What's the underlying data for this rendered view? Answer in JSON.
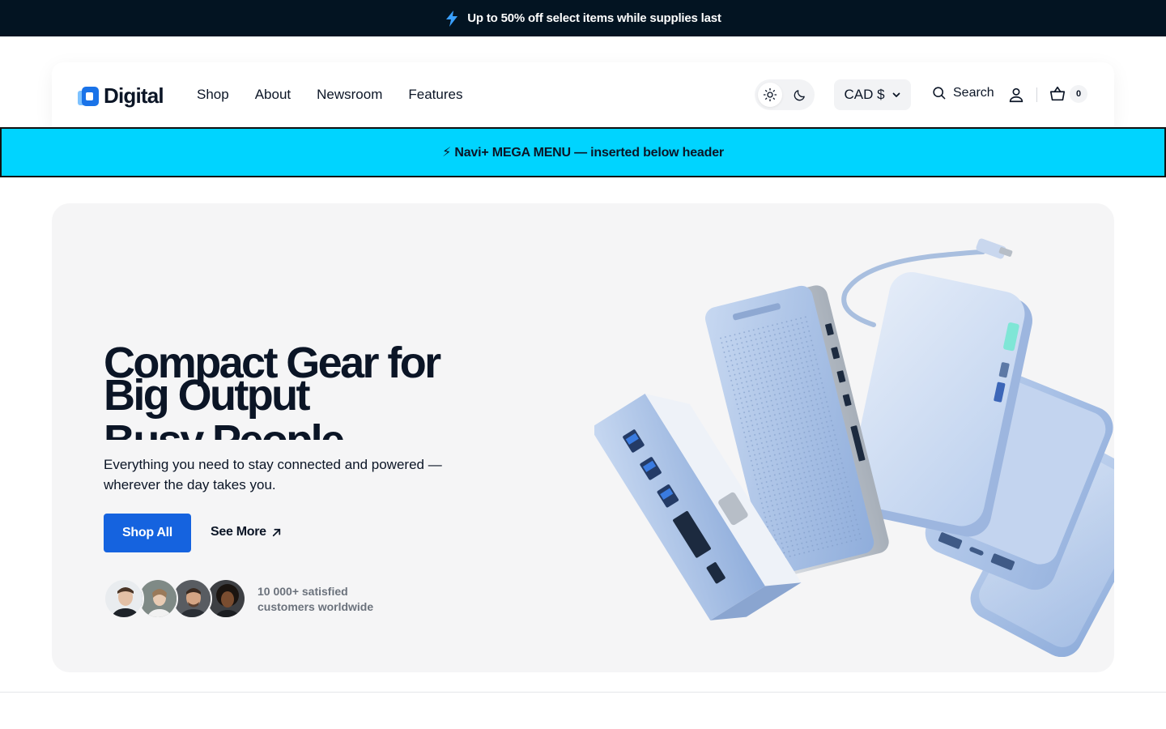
{
  "announcement": {
    "icon": "lightning-icon",
    "text": "Up to 50% off select items while supplies last"
  },
  "header": {
    "logo_text": "Digital",
    "nav": [
      "Shop",
      "About",
      "Newsroom",
      "Features"
    ],
    "theme_toggle": {
      "light_icon": "sun-icon",
      "dark_icon": "moon-icon",
      "selected": "light"
    },
    "currency": "CAD $",
    "search_label": "Search",
    "cart_count": "0"
  },
  "mega_menu": {
    "text": "⚡ Navi+ MEGA MENU — inserted below header"
  },
  "hero": {
    "headline_lines": [
      "Compact Gear for",
      "Big Output",
      "Busy People"
    ],
    "subtext": "Everything you need to stay connected and powered — wherever the day takes you.",
    "primary_cta": "Shop All",
    "secondary_cta": "See More",
    "social_proof": [
      "10 000+ satisfied",
      "customers worldwide"
    ]
  },
  "colors": {
    "announcement_bg": "#031422",
    "mega_menu_bg": "#00d4ff",
    "primary": "#1563df",
    "hero_bg": "#f5f5f6",
    "product_blue": "#a9c1e6"
  }
}
